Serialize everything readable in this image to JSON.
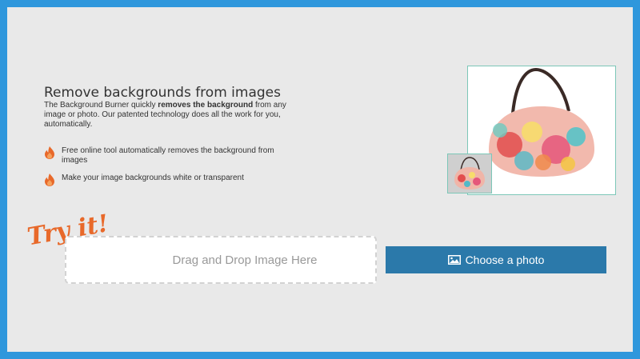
{
  "hero": {
    "title": "Remove backgrounds from images",
    "intro_pre": "The Background Burner quickly ",
    "intro_bold": "removes the background",
    "intro_post": " from any image or photo. Our patented technology does all the work for you, automatically."
  },
  "features": [
    {
      "icon": "flame-icon",
      "text": "Free online tool automatically removes the background from images"
    },
    {
      "icon": "flame-icon",
      "text": "Make your image backgrounds white or transparent"
    }
  ],
  "tryit": {
    "label": "Try it!"
  },
  "upload": {
    "dropzone_label": "Drag and Drop Image Here",
    "choose_label": "Choose a photo"
  },
  "colors": {
    "border": "#2f97dc",
    "background": "#e9e9e9",
    "button": "#2b79aa",
    "accent_orange": "#e8692a"
  }
}
